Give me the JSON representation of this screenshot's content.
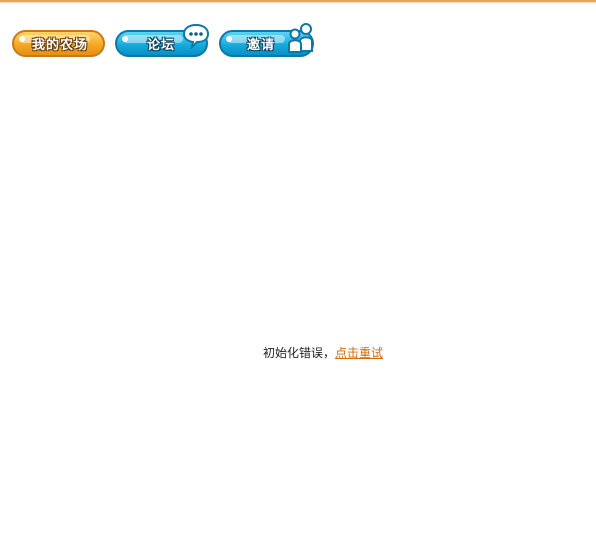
{
  "nav": {
    "farm_label": "我的农场",
    "forum_label": "论坛",
    "invite_label": "邀请"
  },
  "icons": {
    "forum_icon": "chat-bubble",
    "invite_icon": "people"
  },
  "colors": {
    "top_border": "#e8a45a",
    "farm_button": "#f4a51c",
    "blue_button": "#13a8dc",
    "link": "#d06a0c"
  },
  "message": {
    "error_text": "初始化错误，",
    "retry_link": "点击重试"
  }
}
